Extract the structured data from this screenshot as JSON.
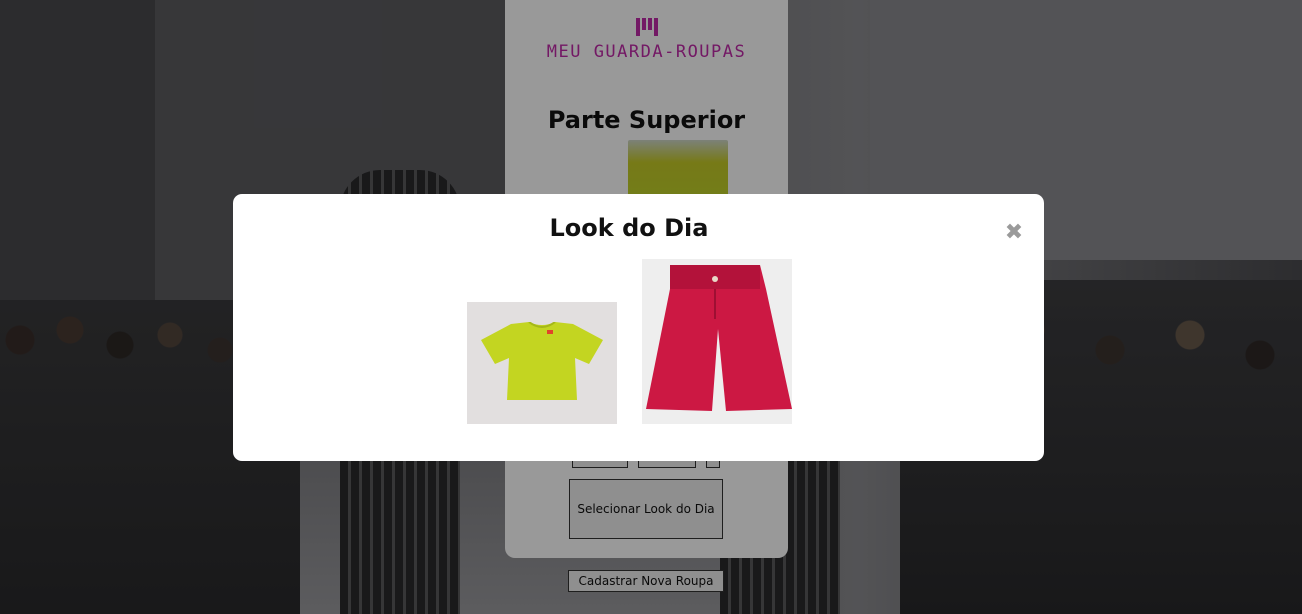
{
  "app": {
    "logo_text": "MEU GUARDA-ROUPAS",
    "brand_color": "#c02aa8"
  },
  "main": {
    "section_title": "Parte Superior",
    "select_look_label": "Selecionar Look do Dia",
    "register_label": "Cadastrar Nova Roupa"
  },
  "modal": {
    "title": "Look do Dia",
    "close_icon": "close-icon",
    "close_glyph": "✖",
    "items": [
      {
        "name": "top-item",
        "color": "#c3d521"
      },
      {
        "name": "bottom-item",
        "color": "#cc1843"
      }
    ]
  }
}
